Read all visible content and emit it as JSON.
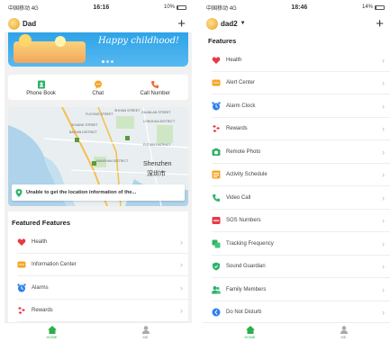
{
  "left": {
    "status": {
      "carrier": "中国移动",
      "network": "4G",
      "time": "16:16",
      "battery": "10%",
      "battery_level": 0.1
    },
    "user": "Dad",
    "banner_text": "Happy childhood!",
    "quick_actions": [
      {
        "label": "Phone Book",
        "icon": "phonebook-icon",
        "color": "#2eb26a"
      },
      {
        "label": "Chat",
        "icon": "chat-icon",
        "color": "#f5a623"
      },
      {
        "label": "Call Number",
        "icon": "call-number-icon",
        "color": "#f06a35"
      }
    ],
    "map": {
      "labels": [
        "FUYONG STREET",
        "XIXIANG STREET",
        "SHIYAN STREET",
        "GUANLAN STREET",
        "LONGHUA DISTRICT",
        "BAO'AN DISTRICT",
        "NANSHAN DISTRICT",
        "FUTIAN DISTRICT"
      ],
      "city_en": "Shenzhen",
      "city_zh": "深圳市",
      "location_text": "Unable to get the location information of the..."
    },
    "section_title": "Featured Features",
    "features": [
      {
        "label": "Health",
        "icon": "heart-icon",
        "color": "#e63946"
      },
      {
        "label": "Information Center",
        "icon": "info-center-icon",
        "color": "#f5a623"
      },
      {
        "label": "Alarms",
        "icon": "alarm-icon",
        "color": "#2f80ed"
      },
      {
        "label": "Rewards",
        "icon": "rewards-icon",
        "color": "#e63946"
      }
    ],
    "tabs": [
      {
        "label": "HOME",
        "active": true
      },
      {
        "label": "ME",
        "active": false
      }
    ]
  },
  "right": {
    "status": {
      "carrier": "中国移动",
      "network": "4G",
      "time": "18:46",
      "battery": "14%",
      "battery_level": 0.14
    },
    "user": "dad2",
    "section_title": "Features",
    "features": [
      {
        "label": "Health",
        "icon": "heart-icon",
        "color": "#e63946"
      },
      {
        "label": "Alert Center",
        "icon": "alert-center-icon",
        "color": "#f5a623"
      },
      {
        "label": "Alarm Clock",
        "icon": "alarm-clock-icon",
        "color": "#2f80ed"
      },
      {
        "label": "Rewards",
        "icon": "rewards-icon",
        "color": "#e63946"
      },
      {
        "label": "Remote Photo",
        "icon": "camera-icon",
        "color": "#2eb26a"
      },
      {
        "label": "Activity Schedule",
        "icon": "schedule-icon",
        "color": "#f5a623"
      },
      {
        "label": "Video Call",
        "icon": "video-call-icon",
        "color": "#2eb26a"
      },
      {
        "label": "SOS Numbers",
        "icon": "sos-icon",
        "color": "#e63946"
      },
      {
        "label": "Tracking Frequency",
        "icon": "tracking-icon",
        "color": "#2eb26a"
      },
      {
        "label": "Sound Guardian",
        "icon": "sound-guardian-icon",
        "color": "#2eb26a"
      },
      {
        "label": "Family Members",
        "icon": "family-icon",
        "color": "#2eb26a"
      },
      {
        "label": "Do Not Disturb",
        "icon": "do-not-disturb-icon",
        "color": "#2f80ed"
      }
    ],
    "tabs": [
      {
        "label": "HOME",
        "active": true
      },
      {
        "label": "ME",
        "active": false
      }
    ]
  }
}
